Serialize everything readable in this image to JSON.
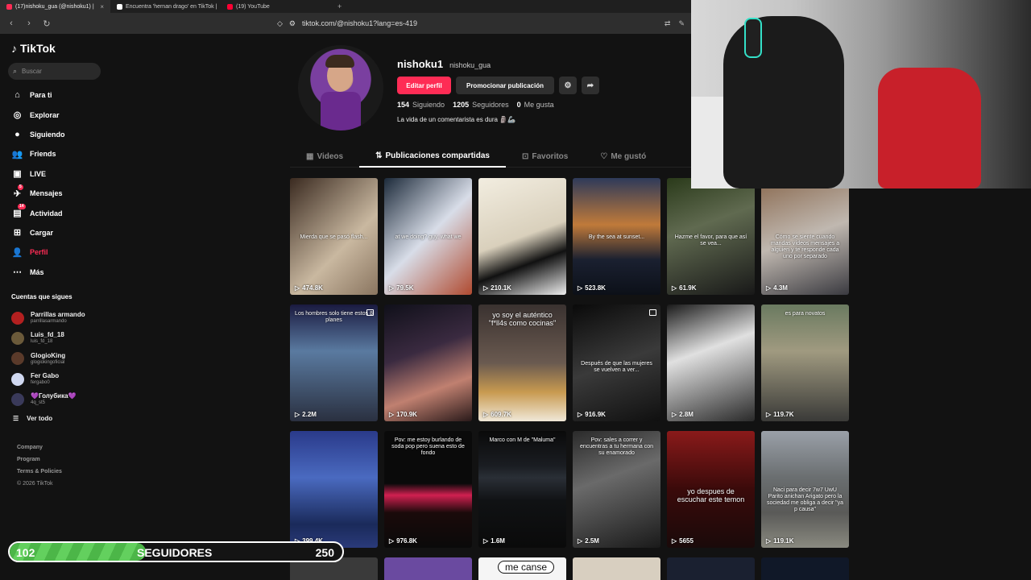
{
  "browser": {
    "tabs": [
      {
        "title": "(17)nishoku_gua (@nishoku1) | ",
        "color": "#fe2c55",
        "active": true
      },
      {
        "title": "Encuentra 'hernan drago' en TikTok |",
        "color": "#ffffff",
        "active": false
      },
      {
        "title": "(19) YouTube",
        "color": "#ff0033",
        "active": false
      }
    ],
    "url": "tiktok.com/@nishoku1?lang=es-419"
  },
  "sidebar": {
    "logo": "TikTok",
    "search_placeholder": "Buscar",
    "nav": [
      {
        "label": "Para ti",
        "icon": "home-icon",
        "glyph": "⌂"
      },
      {
        "label": "Explorar",
        "icon": "compass-icon",
        "glyph": "◎"
      },
      {
        "label": "Siguiendo",
        "icon": "following-avatar-icon",
        "glyph": "●"
      },
      {
        "label": "Friends",
        "icon": "friends-icon",
        "glyph": "👥"
      },
      {
        "label": "LIVE",
        "icon": "live-tv-icon",
        "glyph": "▣"
      },
      {
        "label": "Mensajes",
        "icon": "messages-icon",
        "glyph": "✈",
        "badge": "5"
      },
      {
        "label": "Actividad",
        "icon": "activity-icon",
        "glyph": "▤",
        "badge": "14"
      },
      {
        "label": "Cargar",
        "icon": "upload-icon",
        "glyph": "⊞"
      },
      {
        "label": "Perfil",
        "icon": "profile-icon",
        "glyph": "👤",
        "active": true
      },
      {
        "label": "Más",
        "icon": "more-icon",
        "glyph": "⋯"
      }
    ],
    "following_title": "Cuentas que sigues",
    "following": [
      {
        "name": "Parrillas armando",
        "user": "parrillasarmando",
        "color": "#b32020"
      },
      {
        "name": "Luis_fd_18",
        "user": "luis_fd_18",
        "color": "#6b5a3a"
      },
      {
        "name": "GlogioKing",
        "user": "glogiokingoficial",
        "color": "#5a3a2a"
      },
      {
        "name": "Fer Gabo",
        "user": "fergabo0",
        "color": "#d0d8f0"
      },
      {
        "name": "💜Голубика💜",
        "user": "4q_st5",
        "color": "#3a3a5a"
      }
    ],
    "see_all": "Ver todo",
    "footer": [
      "Company",
      "Program",
      "Terms & Policies"
    ],
    "copyright": "© 2026 TikTok"
  },
  "profile": {
    "username": "nishoku1",
    "display_name": "nishoku_gua",
    "edit_label": "Editar perfil",
    "promote_label": "Promocionar publicación",
    "stats": [
      {
        "value": "154",
        "label": "Siguiendo"
      },
      {
        "value": "1205",
        "label": "Seguidores"
      },
      {
        "value": "0",
        "label": "Me gusta"
      }
    ],
    "bio": "La vida de un comentarista es dura 🗿🦾"
  },
  "tabs": [
    {
      "label": "Videos",
      "glyph": "▦"
    },
    {
      "label": "Publicaciones compartidas",
      "glyph": "⇅",
      "active": true
    },
    {
      "label": "Favoritos",
      "glyph": "⊡"
    },
    {
      "label": "Me gustó",
      "glyph": "♡"
    }
  ],
  "videos": [
    {
      "views": "474.8K",
      "bg": "linear-gradient(135deg,#3a2a20,#c9b8a0 60%,#8a7560)",
      "caption": "Mierda que se pasó flash..."
    },
    {
      "views": "79.5K",
      "bg": "linear-gradient(135deg,#1c2a3a,#d8dde8 50%,#b04a30)",
      "caption": "at we doing?   guy, what we"
    },
    {
      "views": "210.1K",
      "bg": "linear-gradient(160deg,#f2ede0,#d9d0bc 50%,#111 70%,#eee)",
      "caption": ""
    },
    {
      "views": "523.8K",
      "bg": "linear-gradient(180deg,#2e3a5a,#c07a3a 40%,#1a2030 70%,#0c1018)",
      "caption": "By the sea at sunset..."
    },
    {
      "views": "61.9K",
      "bg": "linear-gradient(160deg,#2a3a1a,#606a50 40%,#181818)",
      "caption": "Hazme el favor, para que así se vea..."
    },
    {
      "views": "4.3M",
      "bg": "linear-gradient(160deg,#8a6a50,#c0b8b0 50%,#3a3a40)",
      "caption": "Cómo se siente cuando mandas vídeos mensajes a alguien y te responde cada uno por separado"
    },
    {
      "views": "2.2M",
      "bg": "linear-gradient(180deg,#1a1a40,#5a7aa0 40%,#2a3040)",
      "caption": "Los hombres solo tiene estos 8 planes",
      "multi": true,
      "top": true
    },
    {
      "views": "170.9K",
      "bg": "linear-gradient(160deg,#10101a,#3a2a40 40%,#c08070 70%,#2a1a1a)",
      "caption": ""
    },
    {
      "views": "609.7K",
      "bg": "linear-gradient(180deg,#3a3230,#6a5a50 50%,#c89a50 75%,#f0e8d8)",
      "caption": "yo soy el auténtico \"f*ll4s como cocinas\"",
      "big": true,
      "top": true
    },
    {
      "views": "916.9K",
      "bg": "linear-gradient(160deg,#0a0a0a,#3a3a3a 50%,#101010)",
      "caption": "Después de que las mujeres se vuelven a ver...",
      "multi": true
    },
    {
      "views": "2.8M",
      "bg": "linear-gradient(160deg,#1a1a1a,#e0e0e0 40%,#2a2a2a)",
      "caption": ""
    },
    {
      "views": "119.7K",
      "bg": "linear-gradient(180deg,#6a7a60,#a09a80 40%,#3a3a38)",
      "caption": "es para novatos",
      "top": true
    },
    {
      "views": "399.4K",
      "bg": "linear-gradient(180deg,#2a3a8a,#4a6ac0 40%,#1a2a5a 80%,#2a3a7a)",
      "caption": ""
    },
    {
      "views": "976.8K",
      "bg": "linear-gradient(180deg,#0a0a0a 0%,#0a0a0a 45%,#d02050 55%,#1a0a0a 70%,#0a0a0a)",
      "caption": "Pov: me estoy burlando de soda pop pero suena esto de fondo",
      "top": true
    },
    {
      "views": "1.6M",
      "bg": "linear-gradient(180deg,#0a0a0a 0%,#1a1d22 30%,#2a2f36 40%,#101214 60%,#0a0a0a)",
      "caption": "Marco con M de \"Maluma\"",
      "top": true
    },
    {
      "views": "2.5M",
      "bg": "linear-gradient(160deg,#2a2a2a,#6a6a6a 40%,#1a1a1a)",
      "caption": "Pov: sales a correr y encuentras a tu hermana con su enamorado",
      "top": true
    },
    {
      "views": "5655",
      "bg": "linear-gradient(180deg,#8a1a1a,#3a0a0a 50%,#1a0a0a)",
      "caption": "yo despues de escuchar este temon",
      "big": true
    },
    {
      "views": "119.1K",
      "bg": "linear-gradient(180deg,#9aa0a8,#6a6e70 40%,#5a5a58 70%,#8a8a80)",
      "caption": "Naci para decir 7w7 UwU Parito anichan Arigato pero la sociedad me obliga a decir \"ya p causa\""
    }
  ],
  "bottom_peek": {
    "caption": "me canse"
  },
  "overlay": {
    "current": "102",
    "label": "SEGUIDORES",
    "goal": "250",
    "progress_fraction": 0.408
  }
}
